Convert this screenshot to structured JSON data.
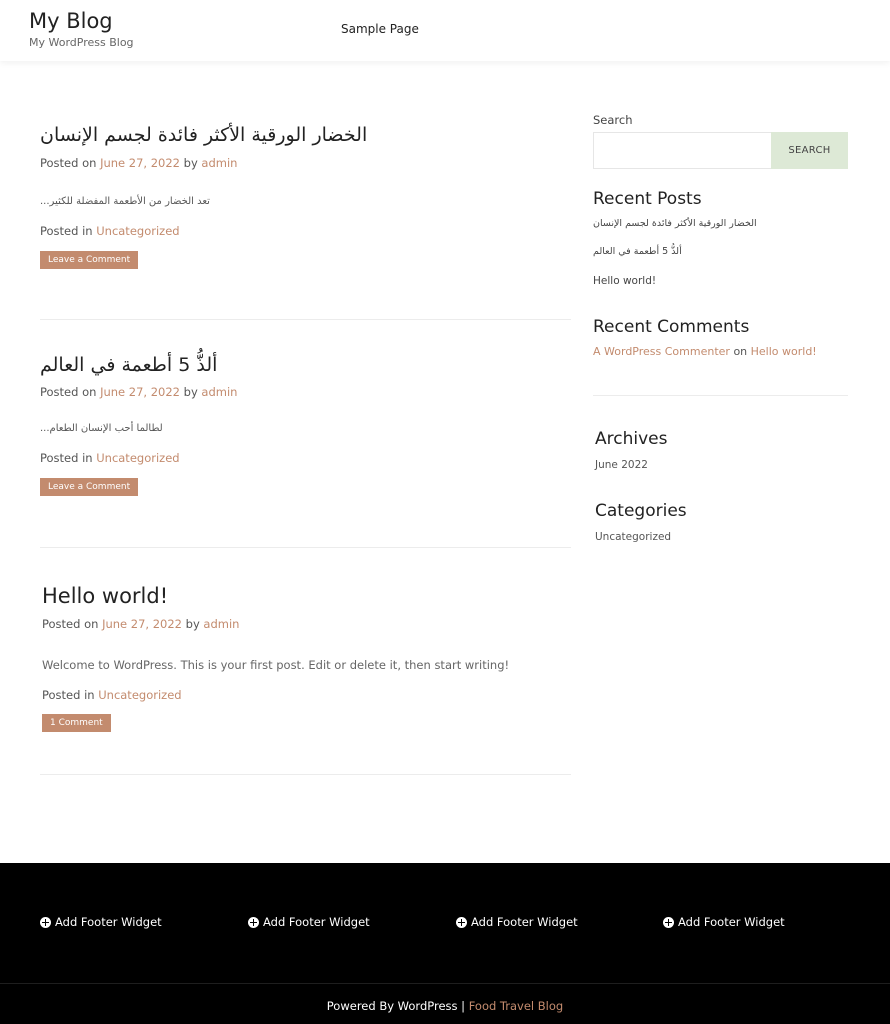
{
  "header": {
    "site_title": "My Blog",
    "tagline": "My WordPress Blog",
    "nav": [
      "Sample Page"
    ]
  },
  "posts": [
    {
      "title": "الخضار الورقية الأكثر فائدة لجسم الإنسان",
      "posted_on_label": "Posted on",
      "date": "June 27, 2022",
      "by_label": "by",
      "author": "admin",
      "excerpt": "...تعد الخضار من الأطعمة المفضلة للكثير",
      "posted_in_label": "Posted in",
      "category": "Uncategorized",
      "comment_button": "Leave a Comment"
    },
    {
      "title": "ألذُّ 5 أطعمة في العالم",
      "posted_on_label": "Posted on",
      "date": "June 27, 2022",
      "by_label": "by",
      "author": "admin",
      "excerpt": "...لطالما أحب الإنسان الطعام",
      "posted_in_label": "Posted in",
      "category": "Uncategorized",
      "comment_button": "Leave a Comment"
    },
    {
      "title": "Hello world!",
      "posted_on_label": "Posted on",
      "date": "June 27, 2022",
      "by_label": "by",
      "author": "admin",
      "excerpt": "Welcome to WordPress. This is your first post. Edit or delete it, then start writing!",
      "posted_in_label": "Posted in",
      "category": "Uncategorized",
      "comment_button": "1 Comment"
    }
  ],
  "sidebar": {
    "search_label": "Search",
    "search_value": "",
    "search_button": "Search",
    "recent_posts_heading": "Recent Posts",
    "recent_posts": [
      "الخضار الورقية الأكثر فائدة لجسم الإنسان",
      "ألذُّ 5 أطعمة في العالم",
      "Hello world!"
    ],
    "recent_comments_heading": "Recent Comments",
    "recent_comment": {
      "author": "A WordPress Commenter",
      "on_label": "on",
      "post": "Hello world!"
    },
    "archives_heading": "Archives",
    "archives": [
      "June 2022"
    ],
    "categories_heading": "Categories",
    "categories": [
      "Uncategorized"
    ]
  },
  "footer": {
    "widgets": [
      "Add Footer Widget",
      "Add Footer Widget",
      "Add Footer Widget",
      "Add Footer Widget"
    ],
    "powered_by": "Powered By WordPress",
    "separator": "|",
    "theme_link": "Food Travel Blog"
  },
  "colors": {
    "accent": "#c38b6e",
    "search_button_bg": "#dde9d6",
    "footer_bg": "#000000"
  }
}
